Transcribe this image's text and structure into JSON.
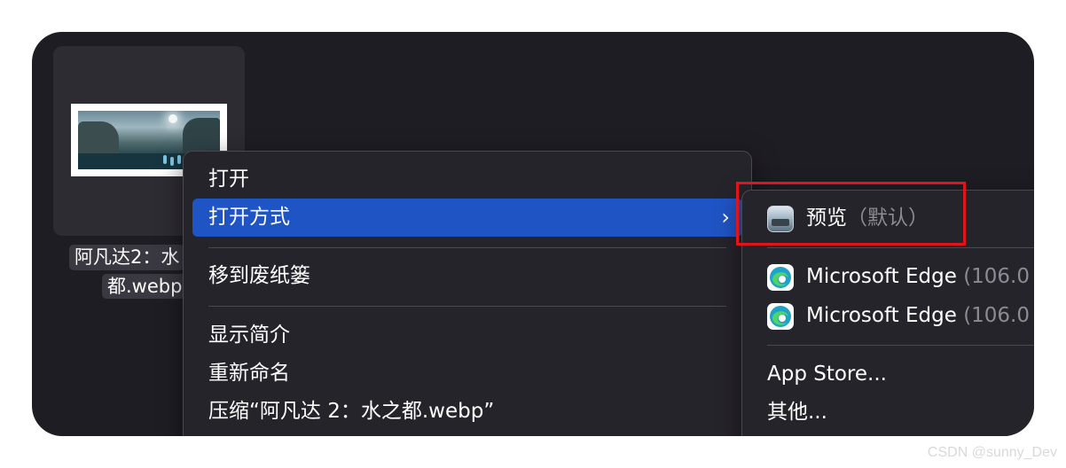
{
  "file": {
    "name_line1": "阿凡达2：水",
    "name_line2": "都.webp"
  },
  "context_menu": {
    "items": [
      {
        "label": "打开"
      },
      {
        "label": "打开方式",
        "has_submenu": true,
        "active": true
      },
      {
        "label": "移到废纸篓"
      },
      {
        "label": "显示简介"
      },
      {
        "label": "重新命名"
      },
      {
        "label": "压缩“阿凡达 2：水之都.webp”"
      }
    ],
    "submenu_chevron": "›"
  },
  "open_with_submenu": {
    "items": [
      {
        "app": "预览",
        "suffix": "（默认）",
        "icon": "preview-icon"
      },
      {
        "app": "Microsoft Edge",
        "suffix": "(106.0",
        "icon": "edge-icon"
      },
      {
        "app": "Microsoft Edge",
        "suffix": "(106.0",
        "icon": "edge-icon"
      },
      {
        "app": "App Store..."
      },
      {
        "app": "其他..."
      }
    ]
  },
  "watermark": "CSDN @sunny_Dev",
  "colors": {
    "menu_active": "#1f54c4",
    "highlight_box": "#e0141b",
    "background": "#1f1d24"
  }
}
